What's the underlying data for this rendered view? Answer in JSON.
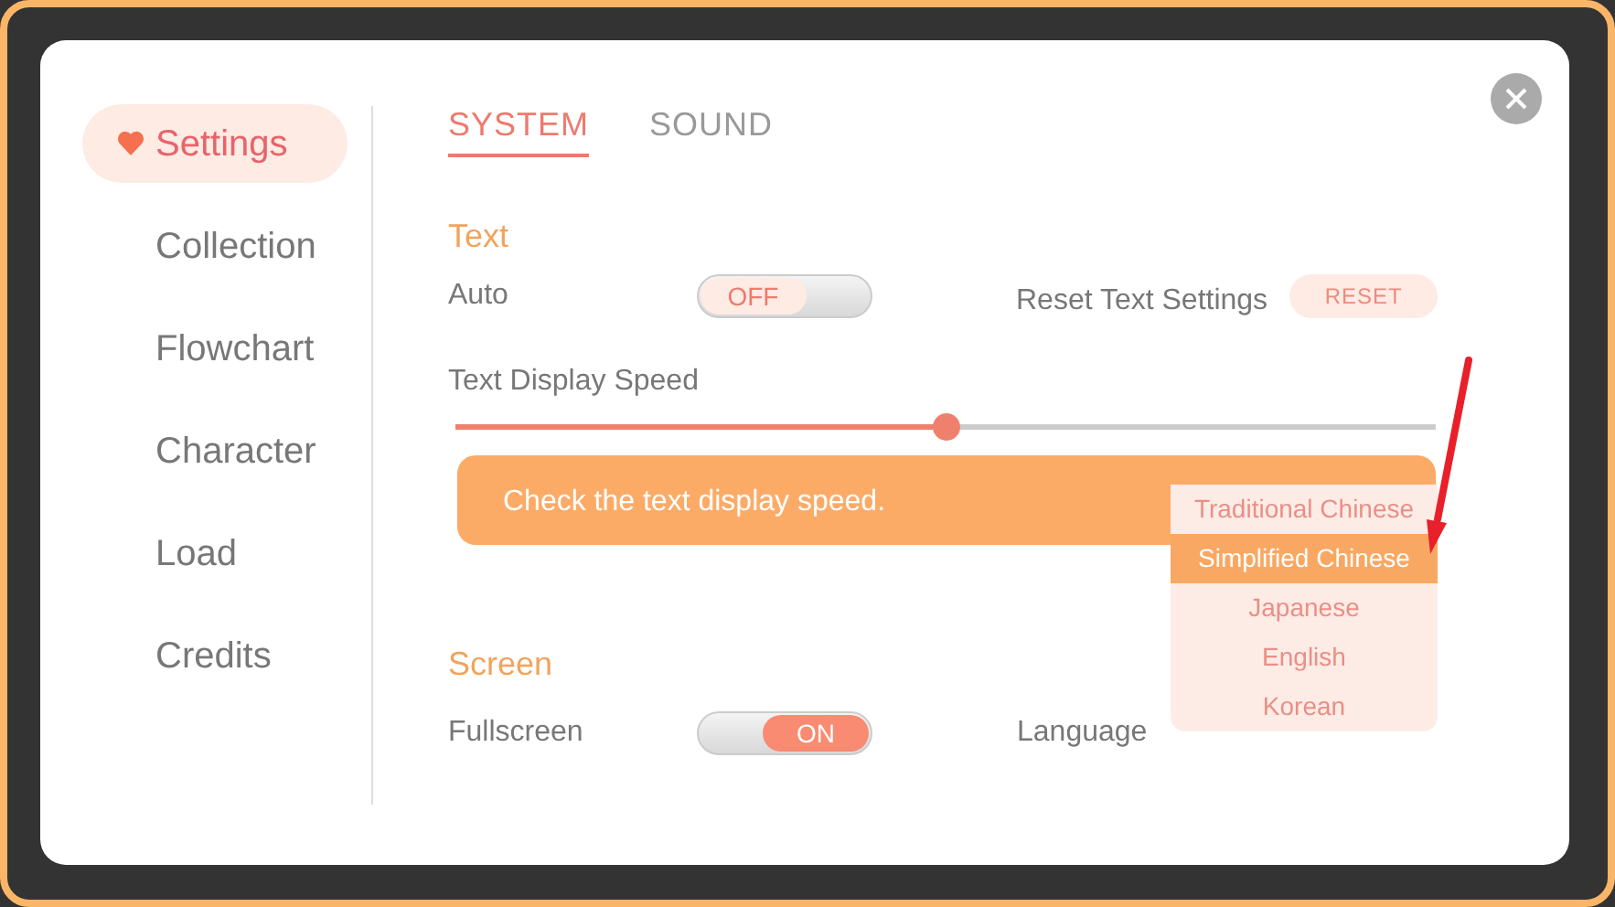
{
  "sidebar": {
    "items": [
      {
        "label": "Settings",
        "selected": true
      },
      {
        "label": "Collection",
        "selected": false
      },
      {
        "label": "Flowchart",
        "selected": false
      },
      {
        "label": "Character",
        "selected": false
      },
      {
        "label": "Load",
        "selected": false
      },
      {
        "label": "Credits",
        "selected": false
      }
    ]
  },
  "tabs": [
    {
      "label": "SYSTEM",
      "selected": true
    },
    {
      "label": "SOUND",
      "selected": false
    }
  ],
  "text_section": {
    "heading": "Text",
    "auto": {
      "label": "Auto",
      "on": false,
      "state_text": "OFF"
    },
    "reset": {
      "label": "Reset Text Settings",
      "button": "RESET"
    },
    "speed": {
      "label": "Text Display Speed",
      "level": 0.5
    },
    "message": "Check the text display speed."
  },
  "screen_section": {
    "heading": "Screen",
    "fullscreen": {
      "label": "Fullscreen",
      "on": true,
      "state_text": "ON"
    },
    "language": {
      "label": "Language",
      "options": [
        {
          "label": "Traditional Chinese",
          "selected": false
        },
        {
          "label": "Simplified Chinese",
          "selected": true
        },
        {
          "label": "Japanese",
          "selected": false
        },
        {
          "label": "English",
          "selected": false
        },
        {
          "label": "Korean",
          "selected": false
        }
      ]
    }
  }
}
